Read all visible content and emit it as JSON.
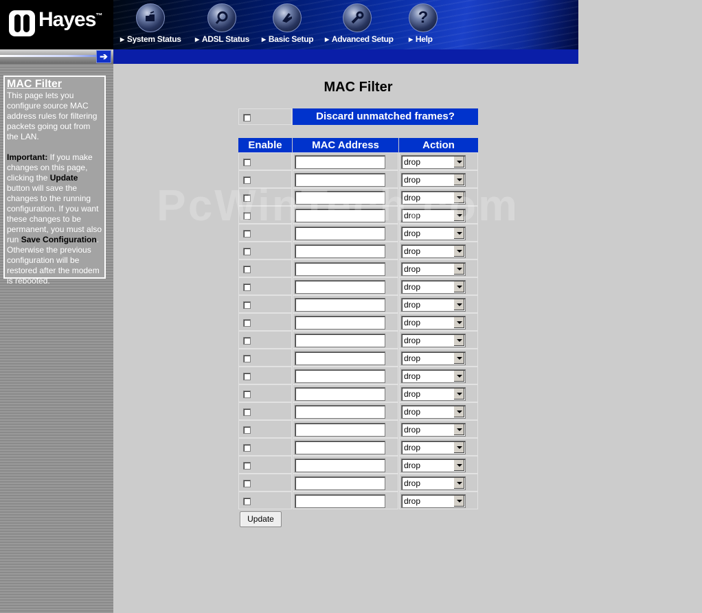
{
  "brand": {
    "name": "Hayes",
    "tm": "™"
  },
  "nav": [
    {
      "id": "system-status",
      "label": "System Status",
      "icon": "folder-icon"
    },
    {
      "id": "adsl-status",
      "label": "ADSL Status",
      "icon": "magnifier-icon"
    },
    {
      "id": "basic-setup",
      "label": "Basic Setup",
      "icon": "hand-icon"
    },
    {
      "id": "advanced-setup",
      "label": "Advanced Setup",
      "icon": "wrench-icon"
    },
    {
      "id": "help",
      "label": "Help",
      "icon": "question-icon"
    }
  ],
  "sidebar": {
    "title": "MAC Filter",
    "intro": "This page lets you configure source MAC address rules for filtering packets going out from the LAN.",
    "important_label": "Important:",
    "p2_a": " If you make changes on this page, clicking the ",
    "update_word": "Update",
    "p2_b": " button will save the changes to the running configuration. If you want these changes to be permanent, you must also run ",
    "save_word": "Save Configuration",
    "p2_c": ". Otherwise the previous configuration will be restored after the modem is rebooted."
  },
  "main": {
    "title": "MAC Filter",
    "discard_label": "Discard unmatched frames?",
    "discard_checked": false,
    "columns": {
      "enable": "Enable",
      "mac": "MAC Address",
      "action": "Action"
    },
    "rows": [
      {
        "enabled": false,
        "mac": "",
        "action": "drop"
      },
      {
        "enabled": false,
        "mac": "",
        "action": "drop"
      },
      {
        "enabled": false,
        "mac": "",
        "action": "drop"
      },
      {
        "enabled": false,
        "mac": "",
        "action": "drop"
      },
      {
        "enabled": false,
        "mac": "",
        "action": "drop"
      },
      {
        "enabled": false,
        "mac": "",
        "action": "drop"
      },
      {
        "enabled": false,
        "mac": "",
        "action": "drop"
      },
      {
        "enabled": false,
        "mac": "",
        "action": "drop"
      },
      {
        "enabled": false,
        "mac": "",
        "action": "drop"
      },
      {
        "enabled": false,
        "mac": "",
        "action": "drop"
      },
      {
        "enabled": false,
        "mac": "",
        "action": "drop"
      },
      {
        "enabled": false,
        "mac": "",
        "action": "drop"
      },
      {
        "enabled": false,
        "mac": "",
        "action": "drop"
      },
      {
        "enabled": false,
        "mac": "",
        "action": "drop"
      },
      {
        "enabled": false,
        "mac": "",
        "action": "drop"
      },
      {
        "enabled": false,
        "mac": "",
        "action": "drop"
      },
      {
        "enabled": false,
        "mac": "",
        "action": "drop"
      },
      {
        "enabled": false,
        "mac": "",
        "action": "drop"
      },
      {
        "enabled": false,
        "mac": "",
        "action": "drop"
      },
      {
        "enabled": false,
        "mac": "",
        "action": "drop"
      }
    ],
    "update_label": "Update"
  },
  "watermark": "PcWinTech.com"
}
